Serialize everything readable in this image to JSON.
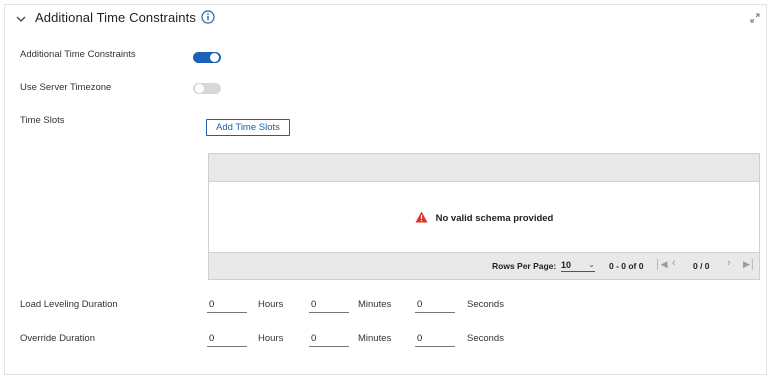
{
  "section": {
    "title": "Additional Time Constraints",
    "expanded": true
  },
  "rows": {
    "additional_time_constraints": {
      "label": "Additional Time Constraints",
      "enabled": true
    },
    "use_server_timezone": {
      "label": "Use Server Timezone",
      "enabled": false
    },
    "time_slots": {
      "label": "Time Slots",
      "button": "Add Time Slots"
    }
  },
  "table": {
    "empty_message": "No valid schema provided",
    "rows_per_page_label": "Rows Per Page:",
    "rows_per_page_value": "10",
    "range_text": "0 - 0 of 0",
    "page_text": "0 / 0"
  },
  "durations": {
    "load_leveling": {
      "label": "Load Leveling Duration",
      "hours": "0",
      "minutes": "0",
      "seconds": "0"
    },
    "override": {
      "label": "Override Duration",
      "hours": "0",
      "minutes": "0",
      "seconds": "0"
    },
    "units": {
      "hours": "Hours",
      "minutes": "Minutes",
      "seconds": "Seconds"
    }
  },
  "colors": {
    "accent": "#1a63b8",
    "warning": "#d9352a"
  }
}
